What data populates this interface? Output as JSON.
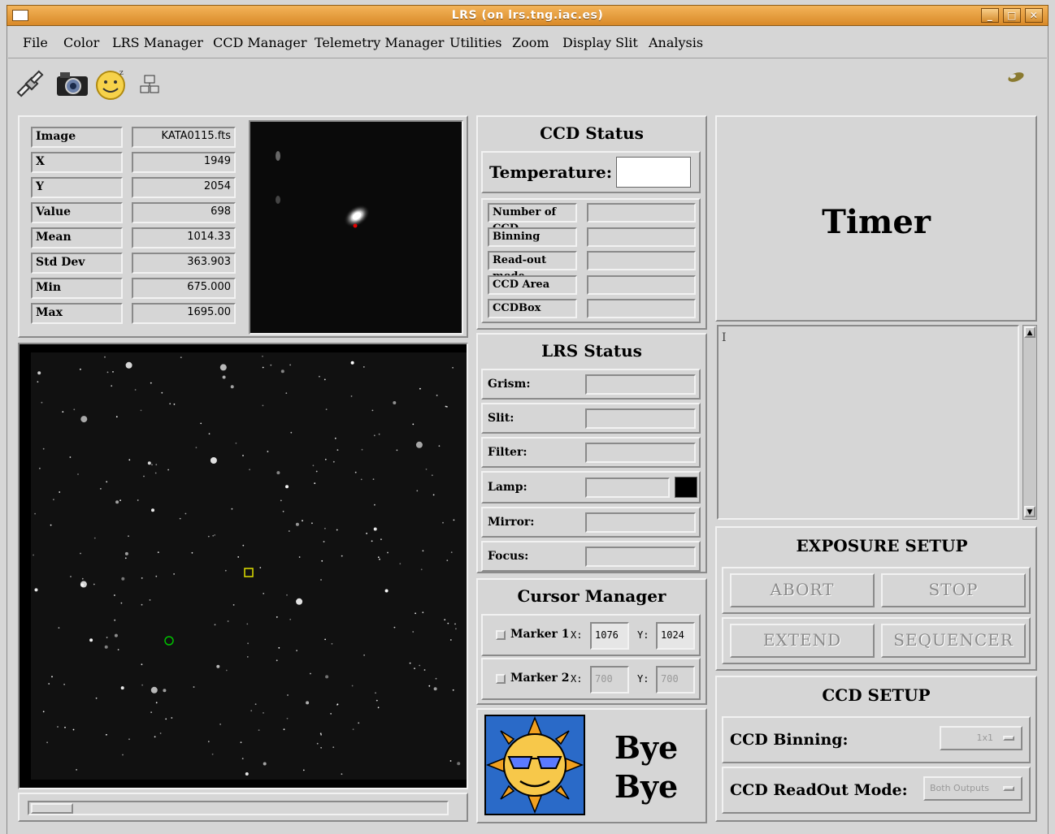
{
  "window": {
    "title": "LRS (on lrs.tng.iac.es)"
  },
  "menu": [
    "File",
    "Color",
    "LRS Manager",
    "CCD Manager",
    "Telemetry Manager",
    "Utilities",
    "Zoom",
    "Display Slit",
    "Analysis"
  ],
  "toolbar": {
    "icons": [
      "satellite-icon",
      "camera-icon",
      "smiley-icon",
      "network-icon"
    ],
    "right_icon": "pill-icon"
  },
  "image_info": [
    {
      "label": "Image",
      "value": "KATA0115.fts"
    },
    {
      "label": "X",
      "value": "1949"
    },
    {
      "label": "Y",
      "value": "2054"
    },
    {
      "label": "Value",
      "value": "698"
    },
    {
      "label": "Mean",
      "value": "1014.33"
    },
    {
      "label": "Std Dev",
      "value": "363.903"
    },
    {
      "label": "Min",
      "value": "675.000"
    },
    {
      "label": "Max",
      "value": "1695.00"
    }
  ],
  "ccd_status": {
    "title": "CCD Status",
    "temperature_label": "Temperature:",
    "temperature_value": "",
    "rows": [
      "Number of CCD",
      "Binning",
      "Read-out mode",
      "CCD Area",
      "CCDBox"
    ]
  },
  "lrs_status": {
    "title": "LRS Status",
    "rows": [
      "Grism:",
      "Slit:",
      "Filter:",
      "Lamp:",
      "Mirror:",
      "Focus:"
    ],
    "lamp_color": "#000000"
  },
  "cursor_manager": {
    "title": "Cursor Manager",
    "markers": [
      {
        "label": "Marker 1",
        "x_label": "X:",
        "x": "1076",
        "y_label": "Y:",
        "y": "1024"
      },
      {
        "label": "Marker 2",
        "x_label": "X:",
        "x": "700",
        "y_label": "Y:",
        "y": "700"
      }
    ]
  },
  "bye": {
    "line1": "Bye",
    "line2": "Bye"
  },
  "timer": {
    "label": "Timer"
  },
  "exposure_setup": {
    "title": "EXPOSURE SETUP",
    "abort": "ABORT",
    "stop": "STOP",
    "extend": "EXTEND",
    "sequencer": "SEQUENCER"
  },
  "ccd_setup": {
    "title": "CCD SETUP",
    "binning_label": "CCD Binning:",
    "binning_value": "1x1",
    "readout_label": "CCD ReadOut Mode:",
    "readout_value": "Both Outputs"
  },
  "colors": {
    "title_bar": "#e59a3a",
    "panel": "#d6d6d6",
    "marker1": "#e0e000",
    "marker2": "#00c000"
  }
}
